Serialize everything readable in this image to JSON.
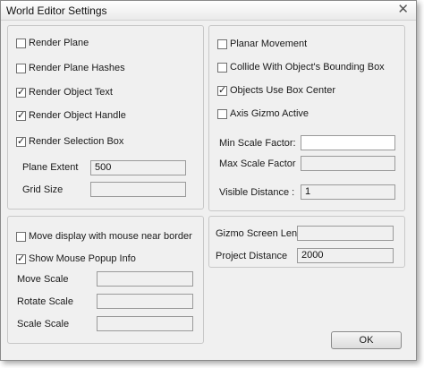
{
  "window": {
    "title": "World Editor Settings",
    "close_glyph": "✕"
  },
  "panel_top_left": {
    "checkboxes": [
      {
        "label": "Render Plane",
        "checked": false
      },
      {
        "label": "Render Plane Hashes",
        "checked": false
      },
      {
        "label": "Render Object Text",
        "checked": true
      },
      {
        "label": "Render Object Handle",
        "checked": true
      },
      {
        "label": "Render Selection Box",
        "checked": true
      }
    ],
    "fields": [
      {
        "label": "Plane Extent",
        "value": "500"
      },
      {
        "label": "Grid Size",
        "value": ""
      }
    ]
  },
  "panel_top_right": {
    "checkboxes": [
      {
        "label": "Planar Movement",
        "checked": false
      },
      {
        "label": "Collide With Object's Bounding Box",
        "checked": false
      },
      {
        "label": "Objects Use Box Center",
        "checked": true
      },
      {
        "label": "Axis Gizmo Active",
        "checked": false
      }
    ],
    "fields": [
      {
        "label": "Min Scale Factor:",
        "value": ""
      },
      {
        "label": "Max Scale Factor",
        "value": ""
      },
      {
        "label": "Visible Distance :",
        "value": "1"
      }
    ]
  },
  "panel_bottom_left": {
    "checkboxes": [
      {
        "label": "Move display with mouse near border",
        "checked": false
      },
      {
        "label": "Show Mouse Popup Info",
        "checked": true
      }
    ],
    "fields": [
      {
        "label": "Move Scale",
        "value": ""
      },
      {
        "label": "Rotate Scale",
        "value": ""
      },
      {
        "label": "Scale Scale",
        "value": ""
      }
    ]
  },
  "panel_bottom_right": {
    "fields": [
      {
        "label": "Gizmo Screen Len",
        "value": ""
      },
      {
        "label": "Project Distance",
        "value": "2000"
      }
    ]
  },
  "buttons": {
    "ok": "OK"
  }
}
